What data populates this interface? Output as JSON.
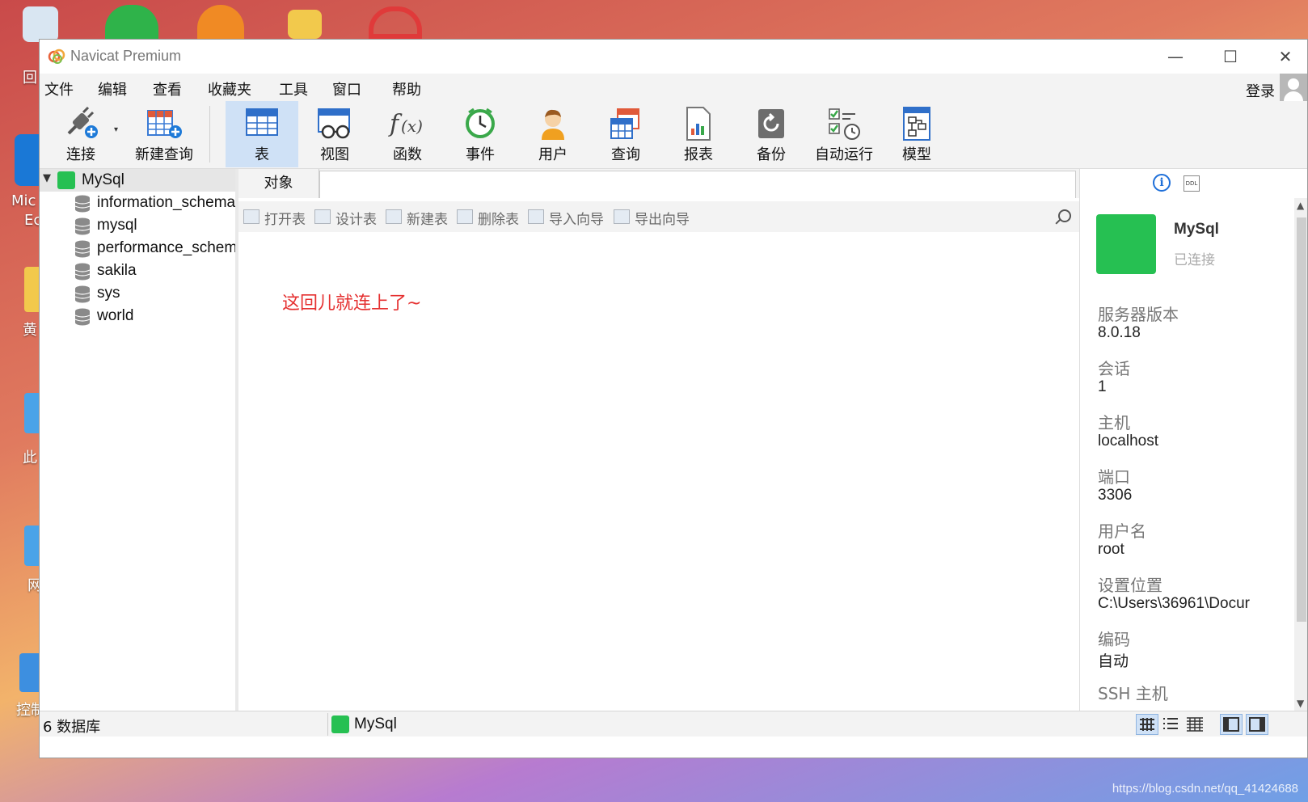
{
  "desktop": {
    "partial_labels": [
      "回",
      "Mic",
      "Ec",
      "黄",
      "此",
      "网",
      "控制"
    ],
    "watermark": "https://blog.csdn.net/qq_41424688"
  },
  "window": {
    "title": "Navicat Premium",
    "controls": {
      "minimize": "—",
      "maximize": "☐",
      "close": "✕"
    }
  },
  "menu": {
    "items": [
      "文件",
      "编辑",
      "查看",
      "收藏夹",
      "工具",
      "窗口",
      "帮助"
    ],
    "login": "登录"
  },
  "toolbar": {
    "items": [
      {
        "label": "连接",
        "icon": "plug-icon"
      },
      {
        "label": "新建查询",
        "icon": "new-query-icon"
      },
      {
        "label": "表",
        "icon": "table-icon",
        "active": true
      },
      {
        "label": "视图",
        "icon": "view-icon"
      },
      {
        "label": "函数",
        "icon": "function-icon"
      },
      {
        "label": "事件",
        "icon": "alarm-clock-icon"
      },
      {
        "label": "用户",
        "icon": "user-icon"
      },
      {
        "label": "查询",
        "icon": "query-icon"
      },
      {
        "label": "报表",
        "icon": "report-icon"
      },
      {
        "label": "备份",
        "icon": "backup-icon"
      },
      {
        "label": "自动运行",
        "icon": "schedule-icon"
      },
      {
        "label": "模型",
        "icon": "model-icon"
      }
    ]
  },
  "tree": {
    "connection": "MySql",
    "databases": [
      "information_schema",
      "mysql",
      "performance_schema",
      "sakila",
      "sys",
      "world"
    ]
  },
  "tabs": {
    "object_tab": "对象"
  },
  "object_toolbar": [
    "打开表",
    "设计表",
    "新建表",
    "删除表",
    "导入向导",
    "导出向导"
  ],
  "content": {
    "annotation": "这回儿就连上了~"
  },
  "info_panel": {
    "connection_name": "MySql",
    "status": "已连接",
    "ddl_label": "DDL",
    "info_glyph": "i",
    "properties": [
      {
        "label": "服务器版本",
        "value": "8.0.18"
      },
      {
        "label": "会话",
        "value": "1"
      },
      {
        "label": "主机",
        "value": "localhost"
      },
      {
        "label": "端口",
        "value": "3306"
      },
      {
        "label": "用户名",
        "value": "root"
      },
      {
        "label": "设置位置",
        "value": "C:\\Users\\36961\\Docur"
      },
      {
        "label": "编码",
        "value": "自动"
      },
      {
        "label": "SSH 主机",
        "value": ""
      }
    ]
  },
  "statusbar": {
    "db_count": "6 数据库",
    "connection": "MySql"
  },
  "colors": {
    "accent_active": "#cfe1f6",
    "mysql_green": "#26c052",
    "annotation_red": "#e53030"
  }
}
